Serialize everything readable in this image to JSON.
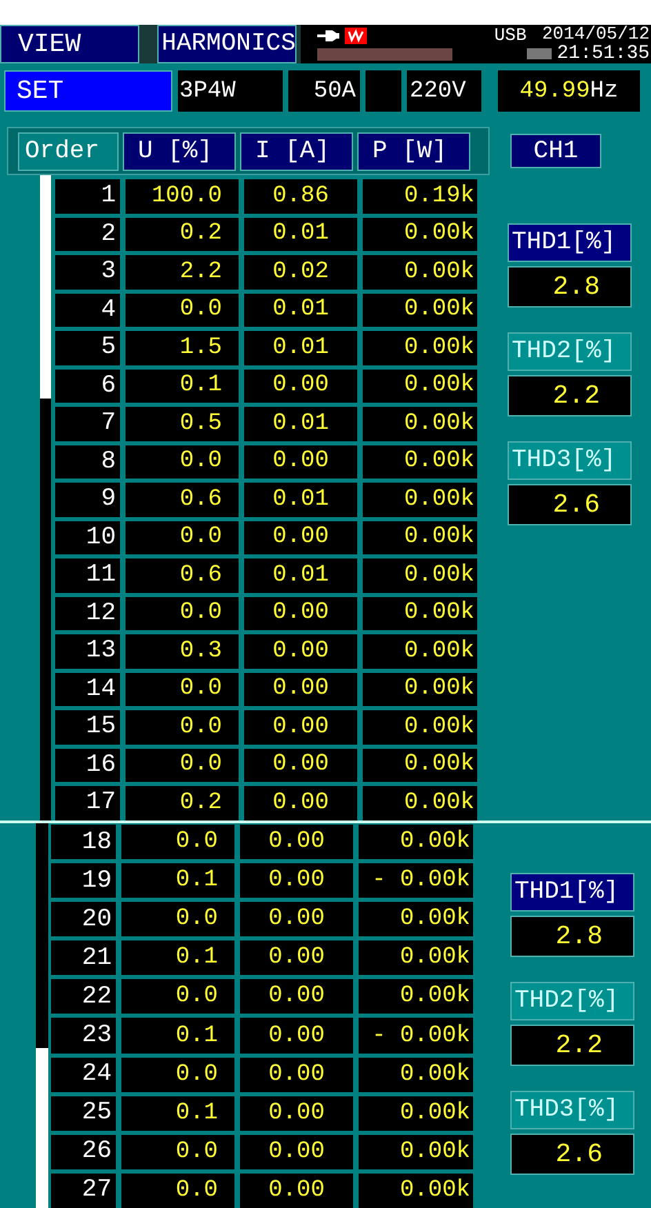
{
  "top_bar": {
    "view_button": "VIEW",
    "mode": "HARMONICS",
    "storage": "USB",
    "date": "2014/05/12",
    "time": "21:51:35"
  },
  "settings_bar": {
    "set_button": "SET",
    "wiring": "3P4W",
    "current_range": "50A",
    "voltage": "220V",
    "frequency_value": "49.99",
    "frequency_unit": "Hz"
  },
  "views": [
    {
      "columns": [
        "Order",
        "U [%]",
        "I [A]",
        "P [W]"
      ],
      "channel": "CH1",
      "rows": [
        {
          "order": "1",
          "u": "100.0",
          "i": "0.86",
          "p": "0.19k"
        },
        {
          "order": "2",
          "u": "0.2",
          "i": "0.01",
          "p": "0.00k"
        },
        {
          "order": "3",
          "u": "2.2",
          "i": "0.02",
          "p": "0.00k"
        },
        {
          "order": "4",
          "u": "0.0",
          "i": "0.01",
          "p": "0.00k"
        },
        {
          "order": "5",
          "u": "1.5",
          "i": "0.01",
          "p": "0.00k"
        },
        {
          "order": "6",
          "u": "0.1",
          "i": "0.00",
          "p": "0.00k"
        },
        {
          "order": "7",
          "u": "0.5",
          "i": "0.01",
          "p": "0.00k"
        },
        {
          "order": "8",
          "u": "0.0",
          "i": "0.00",
          "p": "0.00k"
        },
        {
          "order": "9",
          "u": "0.6",
          "i": "0.01",
          "p": "0.00k"
        },
        {
          "order": "10",
          "u": "0.0",
          "i": "0.00",
          "p": "0.00k"
        },
        {
          "order": "11",
          "u": "0.6",
          "i": "0.01",
          "p": "0.00k"
        },
        {
          "order": "12",
          "u": "0.0",
          "i": "0.00",
          "p": "0.00k"
        },
        {
          "order": "13",
          "u": "0.3",
          "i": "0.00",
          "p": "0.00k"
        },
        {
          "order": "14",
          "u": "0.0",
          "i": "0.00",
          "p": "0.00k"
        },
        {
          "order": "15",
          "u": "0.0",
          "i": "0.00",
          "p": "0.00k"
        },
        {
          "order": "16",
          "u": "0.0",
          "i": "0.00",
          "p": "0.00k"
        },
        {
          "order": "17",
          "u": "0.2",
          "i": "0.00",
          "p": "0.00k"
        }
      ],
      "thd": [
        {
          "label": "THD1[%]",
          "value": "2.8",
          "selected": true
        },
        {
          "label": "THD2[%]",
          "value": "2.2",
          "selected": false
        },
        {
          "label": "THD3[%]",
          "value": "2.6",
          "selected": false
        }
      ]
    },
    {
      "rows": [
        {
          "order": "18",
          "u": "0.0",
          "i": "0.00",
          "p": "0.00k"
        },
        {
          "order": "19",
          "u": "0.1",
          "i": "0.00",
          "p": "- 0.00k"
        },
        {
          "order": "20",
          "u": "0.0",
          "i": "0.00",
          "p": "0.00k"
        },
        {
          "order": "21",
          "u": "0.1",
          "i": "0.00",
          "p": "0.00k"
        },
        {
          "order": "22",
          "u": "0.0",
          "i": "0.00",
          "p": "0.00k"
        },
        {
          "order": "23",
          "u": "0.1",
          "i": "0.00",
          "p": "- 0.00k"
        },
        {
          "order": "24",
          "u": "0.0",
          "i": "0.00",
          "p": "0.00k"
        },
        {
          "order": "25",
          "u": "0.1",
          "i": "0.00",
          "p": "0.00k"
        },
        {
          "order": "26",
          "u": "0.0",
          "i": "0.00",
          "p": "0.00k"
        },
        {
          "order": "27",
          "u": "0.0",
          "i": "0.00",
          "p": "0.00k"
        }
      ],
      "thd": [
        {
          "label": "THD1[%]",
          "value": "2.8",
          "selected": true
        },
        {
          "label": "THD2[%]",
          "value": "2.2",
          "selected": false
        },
        {
          "label": "THD3[%]",
          "value": "2.6",
          "selected": false
        }
      ]
    }
  ]
}
